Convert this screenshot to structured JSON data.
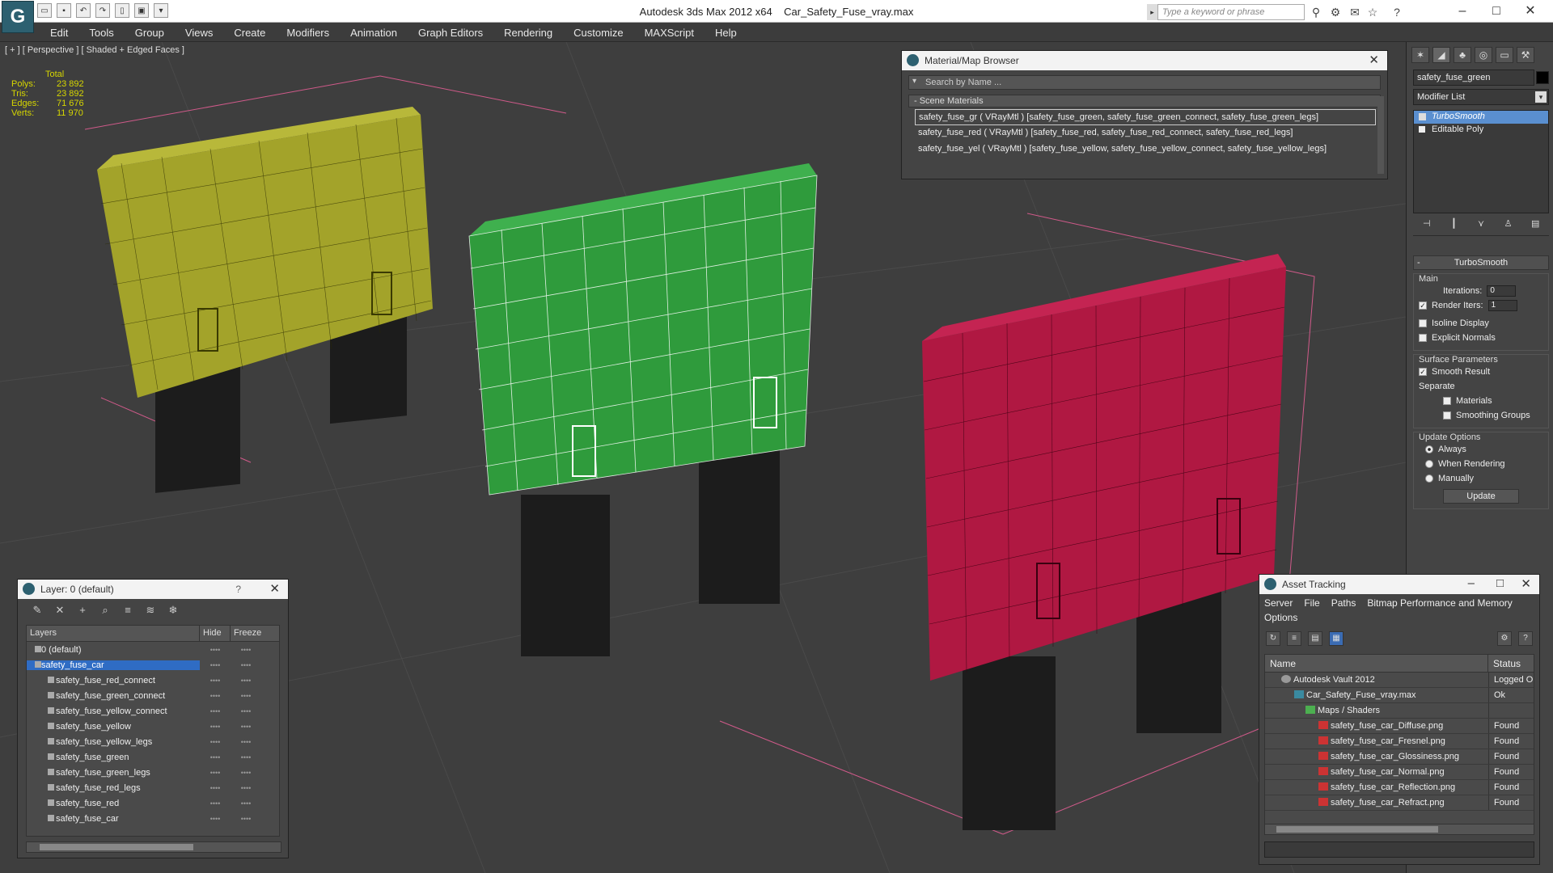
{
  "titlebar": {
    "app": "Autodesk 3ds Max  2012 x64",
    "file": "Car_Safety_Fuse_vray.max",
    "search_placeholder": "Type a keyword or phrase"
  },
  "menu": [
    "Edit",
    "Tools",
    "Group",
    "Views",
    "Create",
    "Modifiers",
    "Animation",
    "Graph Editors",
    "Rendering",
    "Customize",
    "MAXScript",
    "Help"
  ],
  "viewport": {
    "label": "[ + ] [ Perspective ] [ Shaded + Edged Faces ]",
    "stats": {
      "header": "Total",
      "rows": [
        {
          "k": "Polys:",
          "v": "23 892"
        },
        {
          "k": "Tris:",
          "v": "23 892"
        },
        {
          "k": "Edges:",
          "v": "71 676"
        },
        {
          "k": "Verts:",
          "v": "11 970"
        }
      ]
    },
    "fuse_colors": {
      "yellow": "#a3a32a",
      "green": "#2f9b3c",
      "red": "#b01842",
      "legs": "#1c1c1c"
    }
  },
  "material_browser": {
    "title": "Material/Map Browser",
    "search": "Search by Name ...",
    "section": "- Scene Materials",
    "items": [
      "safety_fuse_gr ( VRayMtl ) [safety_fuse_green, safety_fuse_green_connect, safety_fuse_green_legs]",
      "safety_fuse_red ( VRayMtl ) [safety_fuse_red, safety_fuse_red_connect, safety_fuse_red_legs]",
      "safety_fuse_yel ( VRayMtl ) [safety_fuse_yellow, safety_fuse_yellow_connect, safety_fuse_yellow_legs]"
    ]
  },
  "command_panel": {
    "object_name": "safety_fuse_green",
    "modifier_list": "Modifier List",
    "stack": [
      "TurboSmooth",
      "Editable Poly"
    ],
    "rollout_title": "TurboSmooth",
    "main_label": "Main",
    "iterations_label": "Iterations:",
    "iterations_value": "0",
    "render_iters_label": "Render Iters:",
    "render_iters_value": "1",
    "isoline": "Isoline Display",
    "explicit_normals": "Explicit Normals",
    "surface_params": "Surface Parameters",
    "smooth_result": "Smooth Result",
    "separate": "Separate",
    "materials": "Materials",
    "smoothing_groups": "Smoothing Groups",
    "update_options": "Update Options",
    "always": "Always",
    "when_rendering": "When Rendering",
    "manually": "Manually",
    "update_btn": "Update"
  },
  "layer_window": {
    "title": "Layer: 0 (default)",
    "help": "?",
    "columns": [
      "Layers",
      "Hide",
      "Freeze"
    ],
    "rows": [
      {
        "name": "0 (default)",
        "child": false,
        "sel": false
      },
      {
        "name": "safety_fuse_car",
        "child": false,
        "sel": true
      },
      {
        "name": "safety_fuse_red_connect",
        "child": true,
        "sel": false
      },
      {
        "name": "safety_fuse_green_connect",
        "child": true,
        "sel": false
      },
      {
        "name": "safety_fuse_yellow_connect",
        "child": true,
        "sel": false
      },
      {
        "name": "safety_fuse_yellow",
        "child": true,
        "sel": false
      },
      {
        "name": "safety_fuse_yellow_legs",
        "child": true,
        "sel": false
      },
      {
        "name": "safety_fuse_green",
        "child": true,
        "sel": false
      },
      {
        "name": "safety_fuse_green_legs",
        "child": true,
        "sel": false
      },
      {
        "name": "safety_fuse_red_legs",
        "child": true,
        "sel": false
      },
      {
        "name": "safety_fuse_red",
        "child": true,
        "sel": false
      },
      {
        "name": "safety_fuse_car",
        "child": true,
        "sel": false
      }
    ]
  },
  "asset_window": {
    "title": "Asset Tracking",
    "menu": [
      "Server",
      "File",
      "Paths",
      "Bitmap Performance and Memory",
      "Options"
    ],
    "columns": [
      "Name",
      "Status"
    ],
    "rows": [
      {
        "name": "Autodesk Vault 2012",
        "status": "Logged Out",
        "icon": "vault",
        "indent": 20
      },
      {
        "name": "Car_Safety_Fuse_vray.max",
        "status": "Ok",
        "icon": "max",
        "indent": 36
      },
      {
        "name": "Maps / Shaders",
        "status": "",
        "icon": "folder",
        "indent": 50
      },
      {
        "name": "safety_fuse_car_Diffuse.png",
        "status": "Found",
        "icon": "png",
        "indent": 66
      },
      {
        "name": "safety_fuse_car_Fresnel.png",
        "status": "Found",
        "icon": "png",
        "indent": 66
      },
      {
        "name": "safety_fuse_car_Glossiness.png",
        "status": "Found",
        "icon": "png",
        "indent": 66
      },
      {
        "name": "safety_fuse_car_Normal.png",
        "status": "Found",
        "icon": "png",
        "indent": 66
      },
      {
        "name": "safety_fuse_car_Reflection.png",
        "status": "Found",
        "icon": "png",
        "indent": 66
      },
      {
        "name": "safety_fuse_car_Refract.png",
        "status": "Found",
        "icon": "png",
        "indent": 66
      }
    ]
  }
}
